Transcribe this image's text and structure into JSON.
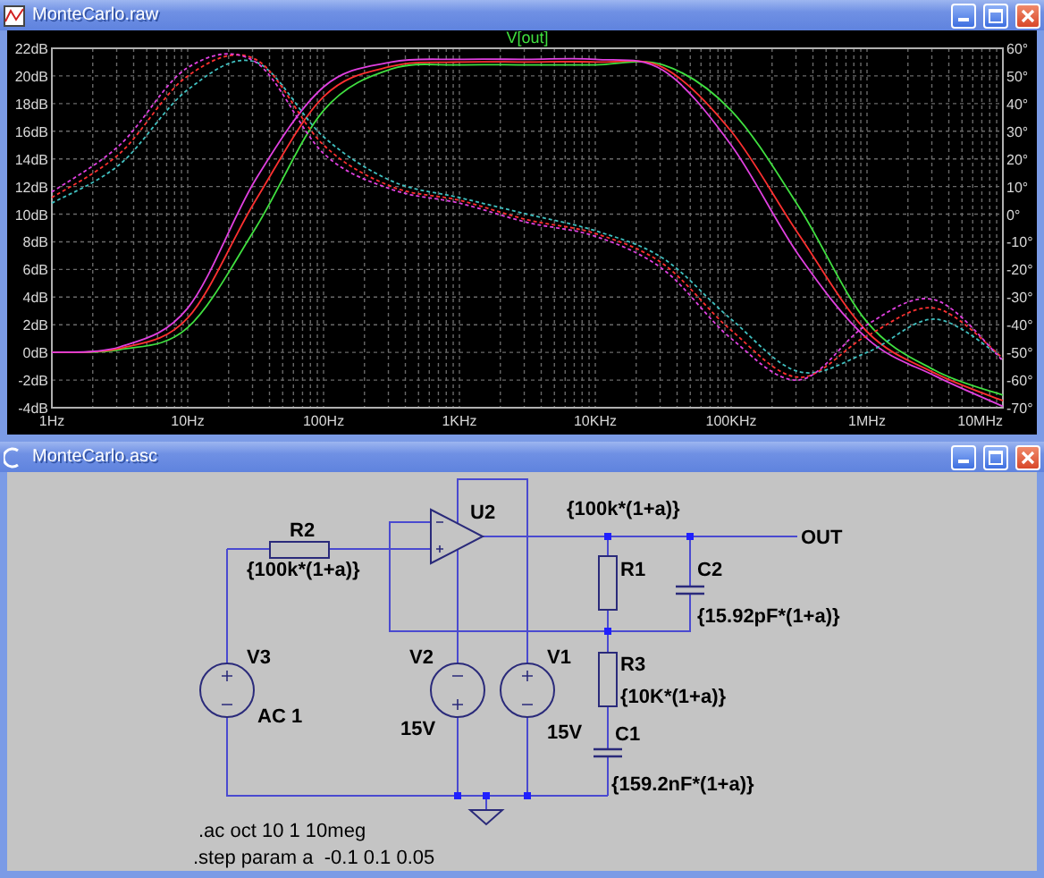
{
  "plot_window": {
    "title": "MonteCarlo.raw",
    "chart_data": {
      "type": "line",
      "title": "V[out]",
      "grid": true,
      "categories": [
        "1Hz",
        null,
        "10Hz",
        null,
        "100Hz",
        null,
        "1KHz",
        null,
        "10KHz",
        null,
        "100KHz",
        null,
        "1MHz",
        null,
        "10MHz"
      ],
      "ylim": [
        -4,
        22
      ],
      "y2lim": [
        -70,
        60
      ],
      "yticks": [
        {
          "value": 22,
          "label": "22dB"
        },
        {
          "value": 20,
          "label": "20dB"
        },
        {
          "value": 18,
          "label": "18dB"
        },
        {
          "value": 16,
          "label": "16dB"
        },
        {
          "value": 14,
          "label": "14dB"
        },
        {
          "value": 12,
          "label": "12dB"
        },
        {
          "value": 10,
          "label": "10dB"
        },
        {
          "value": 8,
          "label": "8dB"
        },
        {
          "value": 6,
          "label": "6dB"
        },
        {
          "value": 4,
          "label": "4dB"
        },
        {
          "value": 2,
          "label": "2dB"
        },
        {
          "value": 0,
          "label": "0dB"
        },
        {
          "value": -2,
          "label": "-2dB"
        },
        {
          "value": -4,
          "label": "-4dB"
        }
      ],
      "y2ticks": [
        {
          "value": 60,
          "label": "60°"
        },
        {
          "value": 50,
          "label": "50°"
        },
        {
          "value": 40,
          "label": "40°"
        },
        {
          "value": 30,
          "label": "30°"
        },
        {
          "value": 20,
          "label": "20°"
        },
        {
          "value": 10,
          "label": "10°"
        },
        {
          "value": 0,
          "label": "0°"
        },
        {
          "value": -10,
          "label": "-10°"
        },
        {
          "value": -20,
          "label": "-20°"
        },
        {
          "value": -30,
          "label": "-30°"
        },
        {
          "value": -40,
          "label": "-40°"
        },
        {
          "value": -50,
          "label": "-50°"
        },
        {
          "value": -60,
          "label": "-60°"
        },
        {
          "value": -70,
          "label": "-70°"
        }
      ],
      "series": [
        {
          "color": "#40e040",
          "values": [
            0,
            0.2,
            1.8,
            9,
            17.5,
            20.5,
            20.8,
            20.8,
            20.8,
            20.8,
            17.5,
            10.5,
            2.2,
            -1.3,
            -3.1
          ]
        },
        {
          "color": "#ff3030",
          "values": [
            0,
            0.3,
            2.5,
            11,
            18.5,
            20.7,
            21,
            21,
            21,
            20.6,
            16,
            8.5,
            1.5,
            -1.5,
            -3.5
          ]
        },
        {
          "color": "#e040e0",
          "values": [
            0,
            0.4,
            3.2,
            12.5,
            19.2,
            21,
            21.2,
            21.2,
            21.2,
            20.4,
            15,
            7,
            1,
            -1.7,
            -3.9
          ]
        },
        {
          "color": "#40c0c0",
          "axis": "y2",
          "line_style": "dashed",
          "values": [
            4,
            18,
            45,
            55,
            28,
            12,
            6,
            0,
            -6,
            -16,
            -38,
            -57,
            -50,
            -38,
            -52
          ]
        },
        {
          "color": "#ff3030",
          "axis": "y2",
          "line_style": "dashed",
          "values": [
            6,
            22,
            50,
            56,
            25,
            10,
            5,
            -2,
            -7,
            -18,
            -42,
            -59,
            -44,
            -34,
            -52
          ]
        },
        {
          "color": "#e040e0",
          "axis": "y2",
          "line_style": "dashed",
          "values": [
            8,
            25,
            53,
            55,
            22,
            9,
            4,
            -3,
            -8,
            -20,
            -45,
            -60,
            -40,
            -31,
            -53
          ]
        }
      ]
    }
  },
  "schematic_window": {
    "title": "MonteCarlo.asc",
    "components": [
      {
        "kind": "opamp",
        "ref": "U2"
      },
      {
        "kind": "resistor",
        "ref": "R2",
        "value": "{100k*(1+a)}"
      },
      {
        "kind": "resistor",
        "ref": "R1",
        "value": "{100k*(1+a)}"
      },
      {
        "kind": "capacitor",
        "ref": "C2",
        "value": "{15.92pF*(1+a)}"
      },
      {
        "kind": "resistor",
        "ref": "R3",
        "value": "{10K*(1+a)}"
      },
      {
        "kind": "capacitor",
        "ref": "C1",
        "value": "{159.2nF*(1+a)}"
      },
      {
        "kind": "source",
        "ref": "V3",
        "value": "AC 1"
      },
      {
        "kind": "source",
        "ref": "V2",
        "value": "15V"
      },
      {
        "kind": "source",
        "ref": "V1",
        "value": "15V"
      }
    ],
    "net_labels": [
      "OUT"
    ],
    "directives": [
      ".ac oct 10 1 10meg",
      ".step param a  -0.1 0.1 0.05"
    ]
  }
}
